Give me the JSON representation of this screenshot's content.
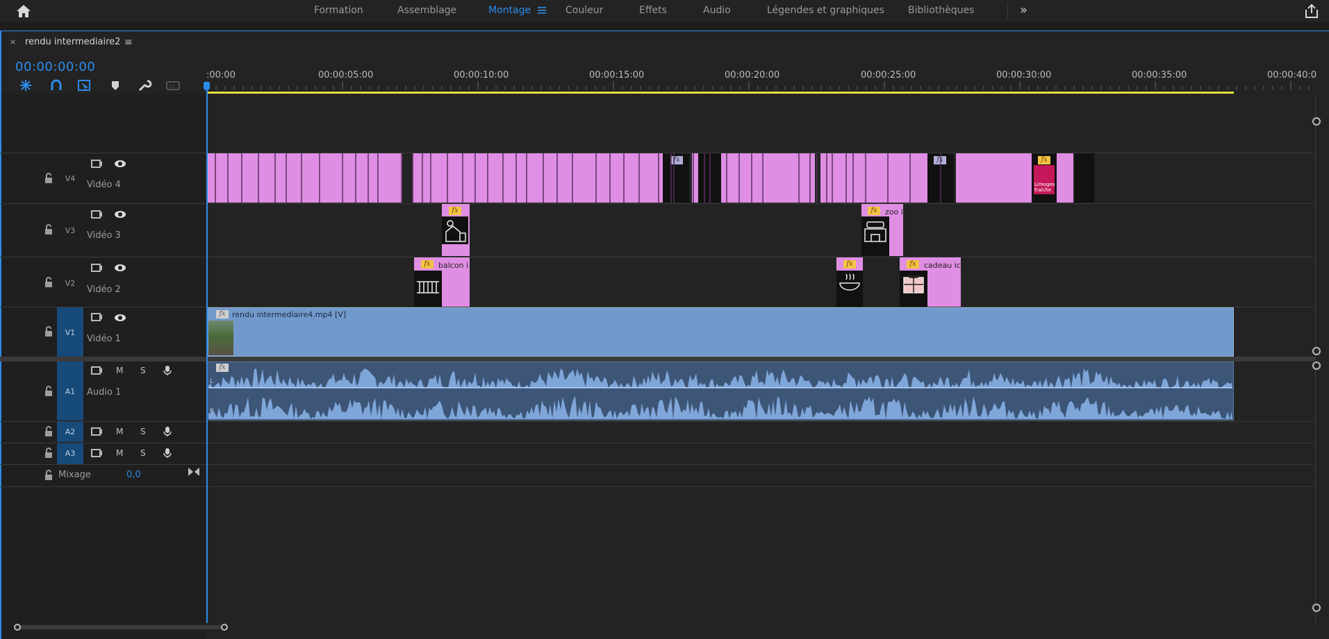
{
  "workspace_tabs": [
    {
      "label": "Formation",
      "active": false
    },
    {
      "label": "Assemblage",
      "active": false
    },
    {
      "label": "Montage",
      "active": true
    },
    {
      "label": "Couleur",
      "active": false
    },
    {
      "label": "Effets",
      "active": false
    },
    {
      "label": "Audio",
      "active": false
    },
    {
      "label": "Légendes et graphiques",
      "active": false
    },
    {
      "label": "Bibliothèques",
      "active": false
    }
  ],
  "more_icon": "»",
  "sequence": {
    "close": "×",
    "title": "rendu intermediaire2",
    "menu": "≡",
    "timecode": "00:00:00:00"
  },
  "tools": [
    "snap-icon",
    "linked-selection-icon",
    "insert-overwrite-icon",
    "marker-icon",
    "wrench-icon",
    "captions-icon"
  ],
  "ruler": {
    "labels": [
      ":00:00",
      "00:00:05:00",
      "00:00:10:00",
      "00:00:15:00",
      "00:00:20:00",
      "00:00:25:00",
      "00:00:30:00",
      "00:00:35:00",
      "00:00:40:0"
    ]
  },
  "tracks": {
    "v4": {
      "id": "V4",
      "name": "Vidéo 4"
    },
    "v3": {
      "id": "V3",
      "name": "Vidéo 3"
    },
    "v2": {
      "id": "V2",
      "name": "Vidéo 2"
    },
    "v1": {
      "id": "V1",
      "name": "Vidéo 1"
    },
    "a1": {
      "id": "A1",
      "name": "Audio 1"
    },
    "a2": {
      "id": "A2"
    },
    "a3": {
      "id": "A3"
    },
    "mute": "M",
    "solo": "S"
  },
  "mix": {
    "label": "Mixage",
    "value": "0,0"
  },
  "clips": {
    "v3_zoo": "zoo i",
    "v2_balcon": "balcon i",
    "v2_cadeau": "cadeau ic",
    "v1": "rendu intermediaire4.mp4 [V]",
    "fx": "fx",
    "a1_channel_l": "L",
    "a1_channel_r": "R",
    "v4_logo_text": "Limoges fraîche"
  },
  "colors": {
    "accent": "#2d8ceb",
    "graphic_clip": "#df8ee3",
    "video_clip": "#7199cb",
    "audio_clip": "#3d5577",
    "work_area": "#e2e03b"
  }
}
